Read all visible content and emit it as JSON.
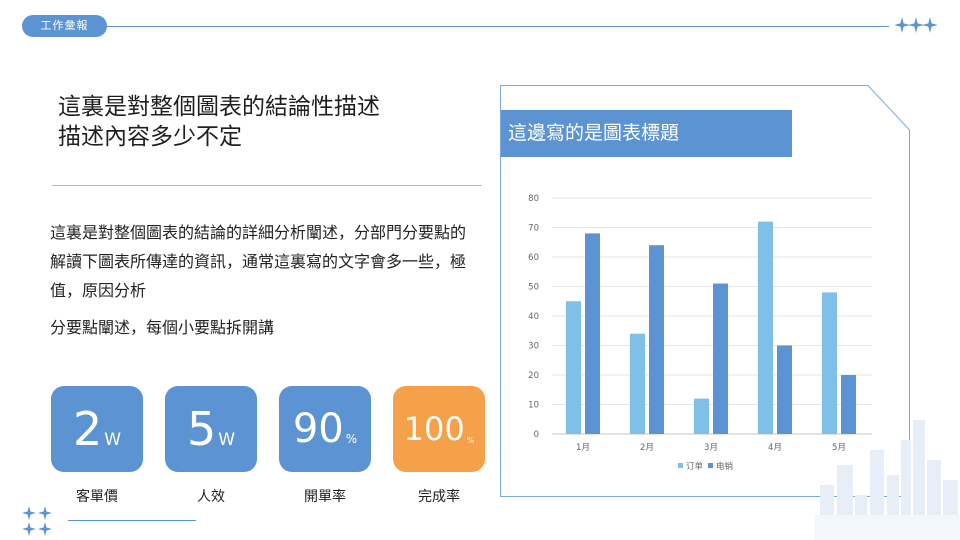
{
  "header": {
    "tag": "工作彙報"
  },
  "headline": {
    "line1": "這裏是對整個圖表的結論性描述",
    "line2": "描述內容多少不定"
  },
  "body": {
    "para1": "這裏是對整個圖表的結論的詳細分析闡述，分部門分要點的解讀下圖表所傳達的資訊，通常這裏寫的文字會多一些，極值，原因分析",
    "para2": "分要點闡述，每個小要點拆開講"
  },
  "stats": [
    {
      "value": "2",
      "unit": "W",
      "label": "客單價"
    },
    {
      "value": "5",
      "unit": "W",
      "label": "人效"
    },
    {
      "value": "90",
      "unit": "%",
      "label": "開單率"
    },
    {
      "value": "100",
      "unit": "%",
      "label": "完成率"
    }
  ],
  "colors": {
    "accent": "#5b93d3",
    "light": "#7fbfe8",
    "orange": "#f5a14a"
  },
  "chart_data": {
    "type": "bar",
    "title": "這邊寫的是圖表標題",
    "categories": [
      "1月",
      "2月",
      "3月",
      "4月",
      "5月"
    ],
    "series": [
      {
        "name": "订单",
        "color": "#7fbfe8",
        "values": [
          45,
          34,
          12,
          72,
          48
        ]
      },
      {
        "name": "电销",
        "color": "#5b93d3",
        "values": [
          68,
          64,
          51,
          30,
          20
        ]
      }
    ],
    "yticks": [
      "0",
      "10",
      "20",
      "30",
      "40",
      "50",
      "60",
      "70",
      "80"
    ],
    "ylim": [
      0,
      80
    ],
    "grid": true,
    "legend": "bottom"
  }
}
